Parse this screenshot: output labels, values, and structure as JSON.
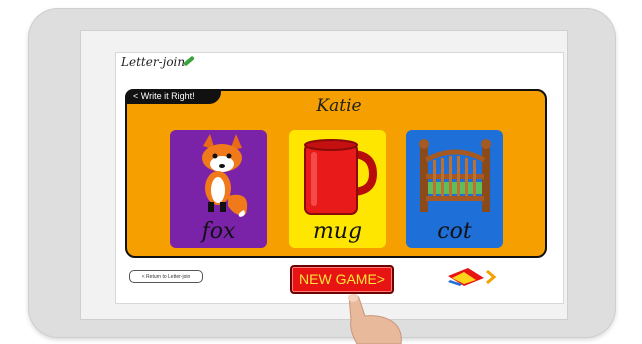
{
  "app": {
    "brand": "Letter-join"
  },
  "nav": {
    "back_label": "< Write it Right!",
    "return_label": "< Return to Letter-join"
  },
  "game": {
    "player_name": "Katie",
    "cards": [
      {
        "word": "fox",
        "icon": "fox-icon",
        "color": "#7a22a8"
      },
      {
        "word": "mug",
        "icon": "mug-icon",
        "color": "#ffe600"
      },
      {
        "word": "cot",
        "icon": "cot-icon",
        "color": "#1f6fd8"
      }
    ],
    "new_game_label": "NEW GAME>",
    "next_icon": "book-next-icon",
    "panel_color": "#f5a000"
  }
}
